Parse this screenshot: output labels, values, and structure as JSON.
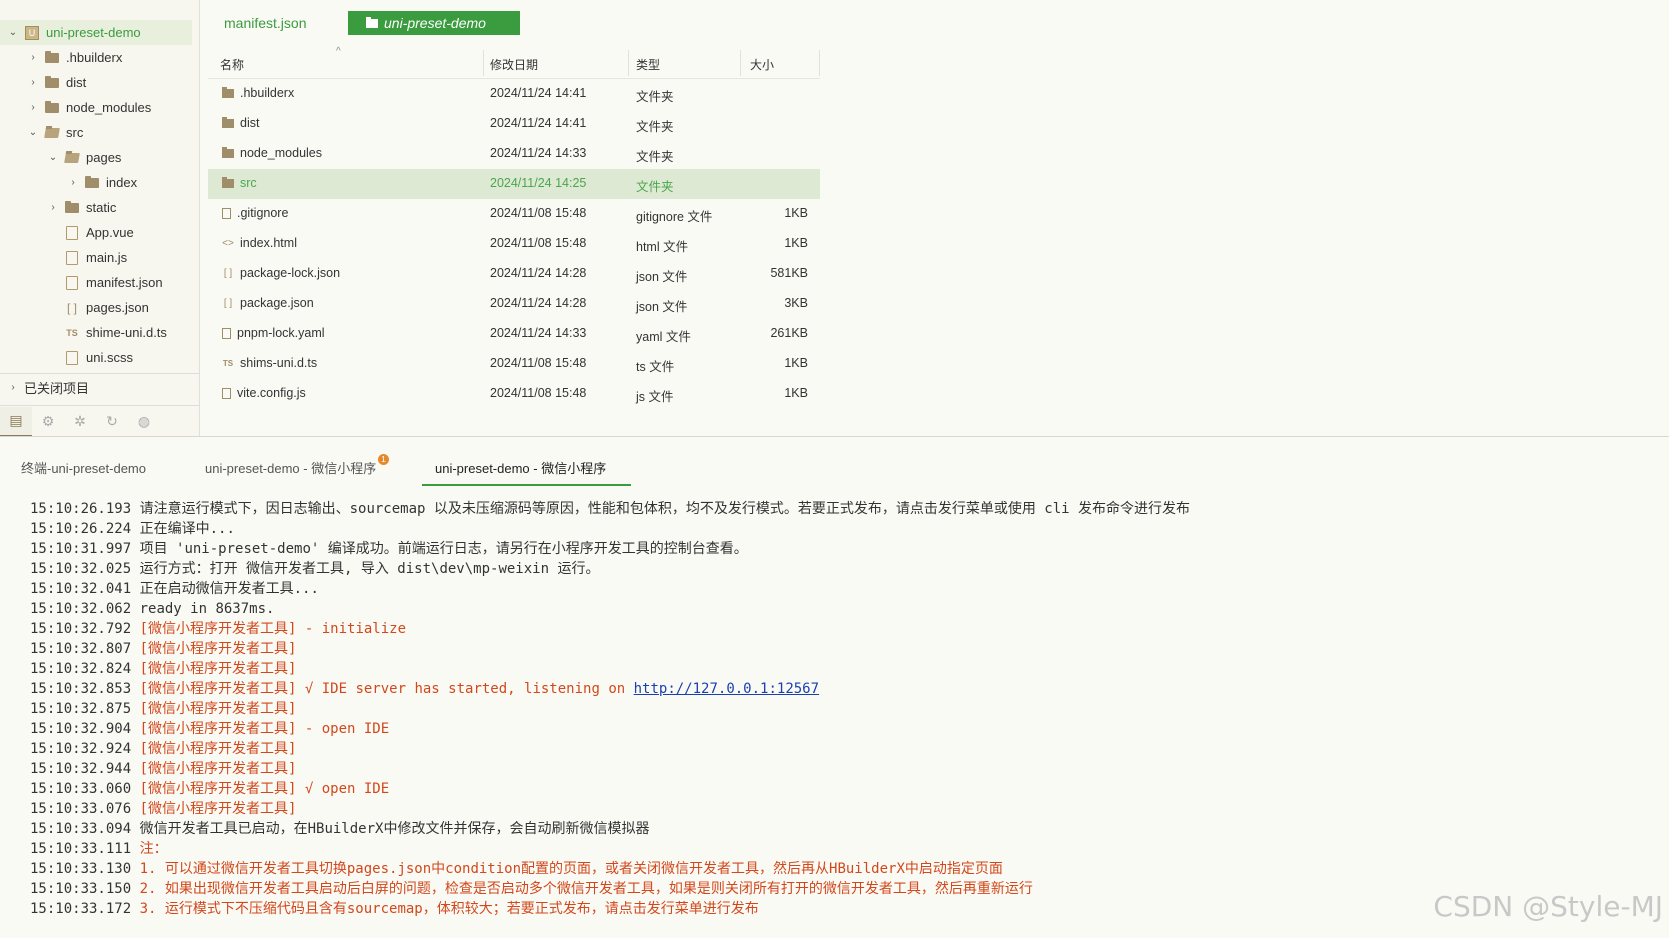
{
  "sidebar": {
    "root": "uni-preset-demo",
    "items": [
      {
        "label": ".hbuilderx",
        "kind": "folder",
        "arrow": "›"
      },
      {
        "label": "dist",
        "kind": "folder",
        "arrow": "›"
      },
      {
        "label": "node_modules",
        "kind": "folder",
        "arrow": "›"
      },
      {
        "label": "src",
        "kind": "folder-open",
        "arrow": "⌄"
      },
      {
        "label": "pages",
        "kind": "folder-open",
        "arrow": "⌄"
      },
      {
        "label": "index",
        "kind": "folder",
        "arrow": "›"
      },
      {
        "label": "static",
        "kind": "folder",
        "arrow": "›"
      },
      {
        "label": "App.vue",
        "kind": "file"
      },
      {
        "label": "main.js",
        "kind": "file"
      },
      {
        "label": "manifest.json",
        "kind": "file"
      },
      {
        "label": "pages.json",
        "kind": "bracket"
      },
      {
        "label": "shime-uni.d.ts",
        "kind": "ts"
      },
      {
        "label": "uni.scss",
        "kind": "file"
      }
    ],
    "closed_projects": "已关闭项目",
    "ts_icon_text": "TS",
    "bracket_icon_text": "[ ]",
    "proj_icon_text": "U"
  },
  "editor_tabs": {
    "tab1": "manifest.json",
    "tab2": "uni-preset-demo"
  },
  "file_table": {
    "headers": {
      "name": "名称",
      "date": "修改日期",
      "type": "类型",
      "size": "大小"
    },
    "rows": [
      {
        "name": ".hbuilderx",
        "date": "2024/11/24 14:41",
        "type": "文件夹",
        "size": "",
        "icon": "folder"
      },
      {
        "name": "dist",
        "date": "2024/11/24 14:41",
        "type": "文件夹",
        "size": "",
        "icon": "folder"
      },
      {
        "name": "node_modules",
        "date": "2024/11/24 14:33",
        "type": "文件夹",
        "size": "",
        "icon": "folder"
      },
      {
        "name": "src",
        "date": "2024/11/24 14:25",
        "type": "文件夹",
        "size": "",
        "icon": "folder",
        "selected": true
      },
      {
        "name": ".gitignore",
        "date": "2024/11/08 15:48",
        "type": "gitignore 文件",
        "size": "1KB",
        "icon": "doc"
      },
      {
        "name": "index.html",
        "date": "2024/11/08 15:48",
        "type": "html 文件",
        "size": "1KB",
        "icon": "code"
      },
      {
        "name": "package-lock.json",
        "date": "2024/11/24 14:28",
        "type": "json 文件",
        "size": "581KB",
        "icon": "bracket"
      },
      {
        "name": "package.json",
        "date": "2024/11/24 14:28",
        "type": "json 文件",
        "size": "3KB",
        "icon": "bracket"
      },
      {
        "name": "pnpm-lock.yaml",
        "date": "2024/11/24 14:33",
        "type": "yaml 文件",
        "size": "261KB",
        "icon": "doc"
      },
      {
        "name": "shims-uni.d.ts",
        "date": "2024/11/08 15:48",
        "type": "ts 文件",
        "size": "1KB",
        "icon": "ts"
      },
      {
        "name": "vite.config.js",
        "date": "2024/11/08 15:48",
        "type": "js 文件",
        "size": "1KB",
        "icon": "doc"
      }
    ]
  },
  "terminal": {
    "tabs": [
      "终端-uni-preset-demo",
      "uni-preset-demo - 微信小程序",
      "uni-preset-demo - 微信小程序"
    ],
    "badge": "1",
    "lines": [
      {
        "t": "15:10:26.193",
        "m": "请注意运行模式下，因日志输出、sourcemap 以及未压缩源码等原因，性能和包体积，均不及发行模式。若要正式发布，请点击发行菜单或使用 cli 发布命令进行发布",
        "c": ""
      },
      {
        "t": "15:10:26.224",
        "m": "正在编译中...",
        "c": ""
      },
      {
        "t": "15:10:31.997",
        "m": "项目 'uni-preset-demo' 编译成功。前端运行日志，请另行在小程序开发工具的控制台查看。",
        "c": ""
      },
      {
        "t": "15:10:32.025",
        "m": "运行方式：打开 微信开发者工具, 导入 dist\\dev\\mp-weixin 运行。",
        "c": ""
      },
      {
        "t": "15:10:32.041",
        "m": "正在启动微信开发者工具...",
        "c": ""
      },
      {
        "t": "15:10:32.062",
        "m": "ready in 8637ms.",
        "c": ""
      },
      {
        "t": "15:10:32.792",
        "m": "[微信小程序开发者工具] - initialize",
        "c": "red"
      },
      {
        "t": "15:10:32.807",
        "m": "[微信小程序开发者工具]",
        "c": "red"
      },
      {
        "t": "15:10:32.824",
        "m": "[微信小程序开发者工具]",
        "c": "red"
      },
      {
        "t": "15:10:32.853",
        "m": "[微信小程序开发者工具] √ IDE server has started, listening on ",
        "c": "red",
        "link": "http://127.0.0.1:12567"
      },
      {
        "t": "15:10:32.875",
        "m": "[微信小程序开发者工具]",
        "c": "red"
      },
      {
        "t": "15:10:32.904",
        "m": "[微信小程序开发者工具] - open IDE",
        "c": "red"
      },
      {
        "t": "15:10:32.924",
        "m": "[微信小程序开发者工具]",
        "c": "red"
      },
      {
        "t": "15:10:32.944",
        "m": "[微信小程序开发者工具]",
        "c": "red"
      },
      {
        "t": "15:10:33.060",
        "m": "[微信小程序开发者工具] √ open IDE",
        "c": "red"
      },
      {
        "t": "15:10:33.076",
        "m": "[微信小程序开发者工具]",
        "c": "red"
      },
      {
        "t": "15:10:33.094",
        "m": "微信开发者工具已启动，在HBuilderX中修改文件并保存，会自动刷新微信模拟器",
        "c": ""
      },
      {
        "t": "15:10:33.111",
        "m": "注：",
        "c": "orange"
      },
      {
        "t": "15:10:33.130",
        "m": "1. 可以通过微信开发者工具切换pages.json中condition配置的页面，或者关闭微信开发者工具，然后再从HBuilderX中启动指定页面",
        "c": "orange"
      },
      {
        "t": "15:10:33.150",
        "m": "2. 如果出现微信开发者工具启动后白屏的问题，检查是否启动多个微信开发者工具，如果是则关闭所有打开的微信开发者工具，然后再重新运行",
        "c": "orange"
      },
      {
        "t": "15:10:33.172",
        "m": "3. 运行模式下不压缩代码且含有sourcemap，体积较大；若要正式发布，请点击发行菜单进行发布",
        "c": "orange"
      }
    ]
  },
  "watermark": "CSDN @Style-MJ",
  "colors": {
    "accent": "#3a9b3f",
    "error": "#d2481c",
    "folder": "#a08d6a"
  }
}
